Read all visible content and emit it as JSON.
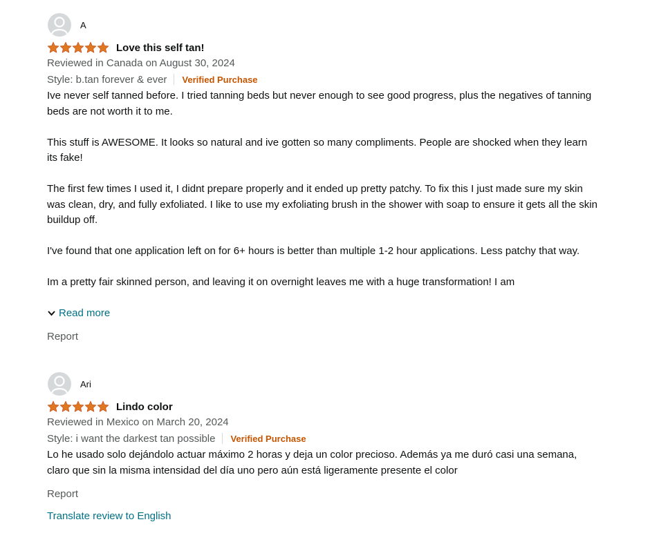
{
  "colors": {
    "star": "#de7921",
    "verified": "#c45500",
    "link": "#007185",
    "muted": "#565959",
    "text": "#0f1111"
  },
  "reviews": [
    {
      "profile_name": "A",
      "avatar_icon": "user-avatar-icon",
      "rating": 5,
      "title": "Love this self tan!",
      "date_text": "Reviewed in Canada on August 30, 2024",
      "style_text": "Style: b.tan forever & ever",
      "verified_label": "Verified Purchase",
      "body": [
        "Ive never self tanned before. I tried tanning beds but never enough to see good progress, plus the negatives of tanning beds are not worth it to me.",
        "This stuff is AWESOME. It looks so natural and ive gotten so many compliments. People are shocked when they learn its fake!",
        "The first few times I used it, I didnt prepare properly and it ended up pretty patchy. To fix this I just made sure my skin was clean, dry, and fully exfoliated. I like to use my exfoliating brush in the shower with soap to ensure it gets all the skin buildup off.",
        "I've found that one application left on for 6+ hours is better than multiple 1-2 hour applications. Less patchy that way.",
        "Im a pretty fair skinned person, and leaving it on overnight leaves me with a huge transformation! I am"
      ],
      "read_more_label": "Read more",
      "read_more_icon": "chevron-down-icon",
      "report_label": "Report"
    },
    {
      "profile_name": "Ari",
      "avatar_icon": "user-avatar-icon",
      "rating": 5,
      "title": "Lindo color",
      "date_text": "Reviewed in Mexico on March 20, 2024",
      "style_text": "Style: i want the darkest tan possible",
      "verified_label": "Verified Purchase",
      "body": [
        "Lo he usado solo dejándolo actuar máximo 2 horas y deja un color precioso. Además ya me duró casi una semana, claro que sin la misma intensidad del día uno pero aún está ligeramente presente el color"
      ],
      "report_label": "Report",
      "translate_label": "Translate review to English"
    }
  ]
}
